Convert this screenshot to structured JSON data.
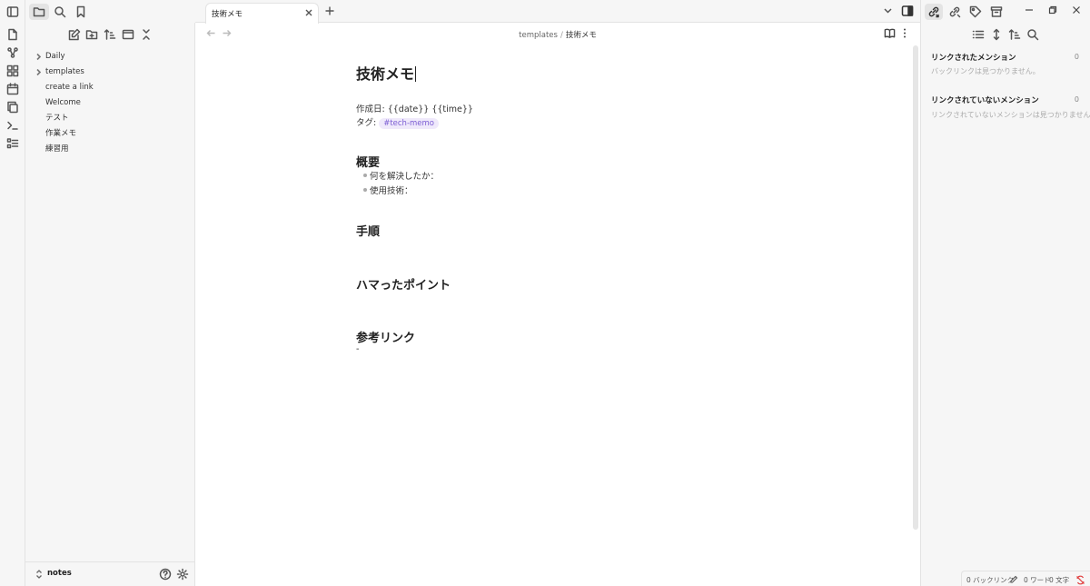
{
  "tab": {
    "title": "技術メモ"
  },
  "breadcrumb": {
    "folder": "templates",
    "separator": "/",
    "current": "技術メモ"
  },
  "sidebar": {
    "items": [
      {
        "label": "Daily",
        "type": "folder"
      },
      {
        "label": "templates",
        "type": "folder"
      },
      {
        "label": "create a link",
        "type": "file"
      },
      {
        "label": "Welcome",
        "type": "file"
      },
      {
        "label": "テスト",
        "type": "file"
      },
      {
        "label": "作業メモ",
        "type": "file"
      },
      {
        "label": "練習用",
        "type": "file"
      }
    ],
    "vault_name": "notes"
  },
  "note": {
    "title": "技術メモ",
    "created_line": "作成日: {{date}} {{time}}",
    "tag_label": "タグ:",
    "tag": "#tech-memo",
    "sections": [
      {
        "heading": "概要",
        "bullets": [
          "何を解決したか：",
          "使用技術："
        ]
      },
      {
        "heading": "手順"
      },
      {
        "heading": "ハマったポイント"
      },
      {
        "heading": "参考リンク",
        "text": "-"
      }
    ]
  },
  "backlinks": {
    "linked": {
      "heading": "リンクされたメンション",
      "count": "0",
      "empty": "バックリンクは見つかりません。"
    },
    "unlinked": {
      "heading": "リンクされていないメンション",
      "count": "0",
      "empty": "リンクされていないメンションは見つかりません。"
    }
  },
  "statusbar": {
    "backlinks": "0 バックリンク",
    "words": "0 ワード",
    "chars": "0 文字"
  },
  "colors": {
    "tag_bg": "#efe9fb",
    "tag_text": "#7b5cd3",
    "sync_error": "#e03e3e"
  },
  "icons": {
    "ribbon": [
      "sidebar-toggle-icon",
      "file-icon",
      "graph-icon",
      "canvas-icon",
      "calendar-icon",
      "copy-icon",
      "terminal-icon",
      "list-icon"
    ],
    "sidebar_top": [
      "folder-icon",
      "search-icon",
      "bookmark-icon"
    ],
    "sidebar_actions": [
      "new-note-icon",
      "new-folder-icon",
      "sort-icon",
      "collapse-view-icon",
      "collapse-all-icon"
    ]
  }
}
